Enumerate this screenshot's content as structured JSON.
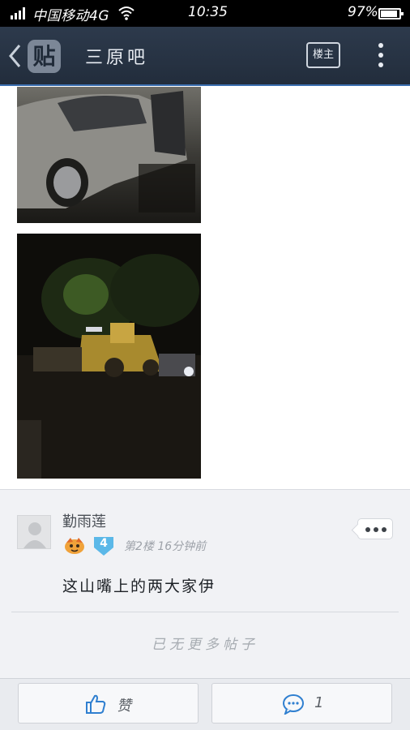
{
  "status_bar": {
    "carrier": "中国移动4G",
    "time": "10:35",
    "battery": "97%"
  },
  "nav": {
    "logo": "贴",
    "title": "三原吧",
    "louzhu": "楼主"
  },
  "reply": {
    "username": "勤雨莲",
    "level": "4",
    "floor_info": "第2楼  16分钟前",
    "content": "这山嘴上的两大家伊",
    "no_more": "已无更多帖子"
  },
  "bottom_bar": {
    "like_label": "赞",
    "comment_count": "1"
  },
  "colors": {
    "nav_bg": "#2d3a4c",
    "accent": "#3b6fb0",
    "level_badge": "#5bb8e8"
  }
}
